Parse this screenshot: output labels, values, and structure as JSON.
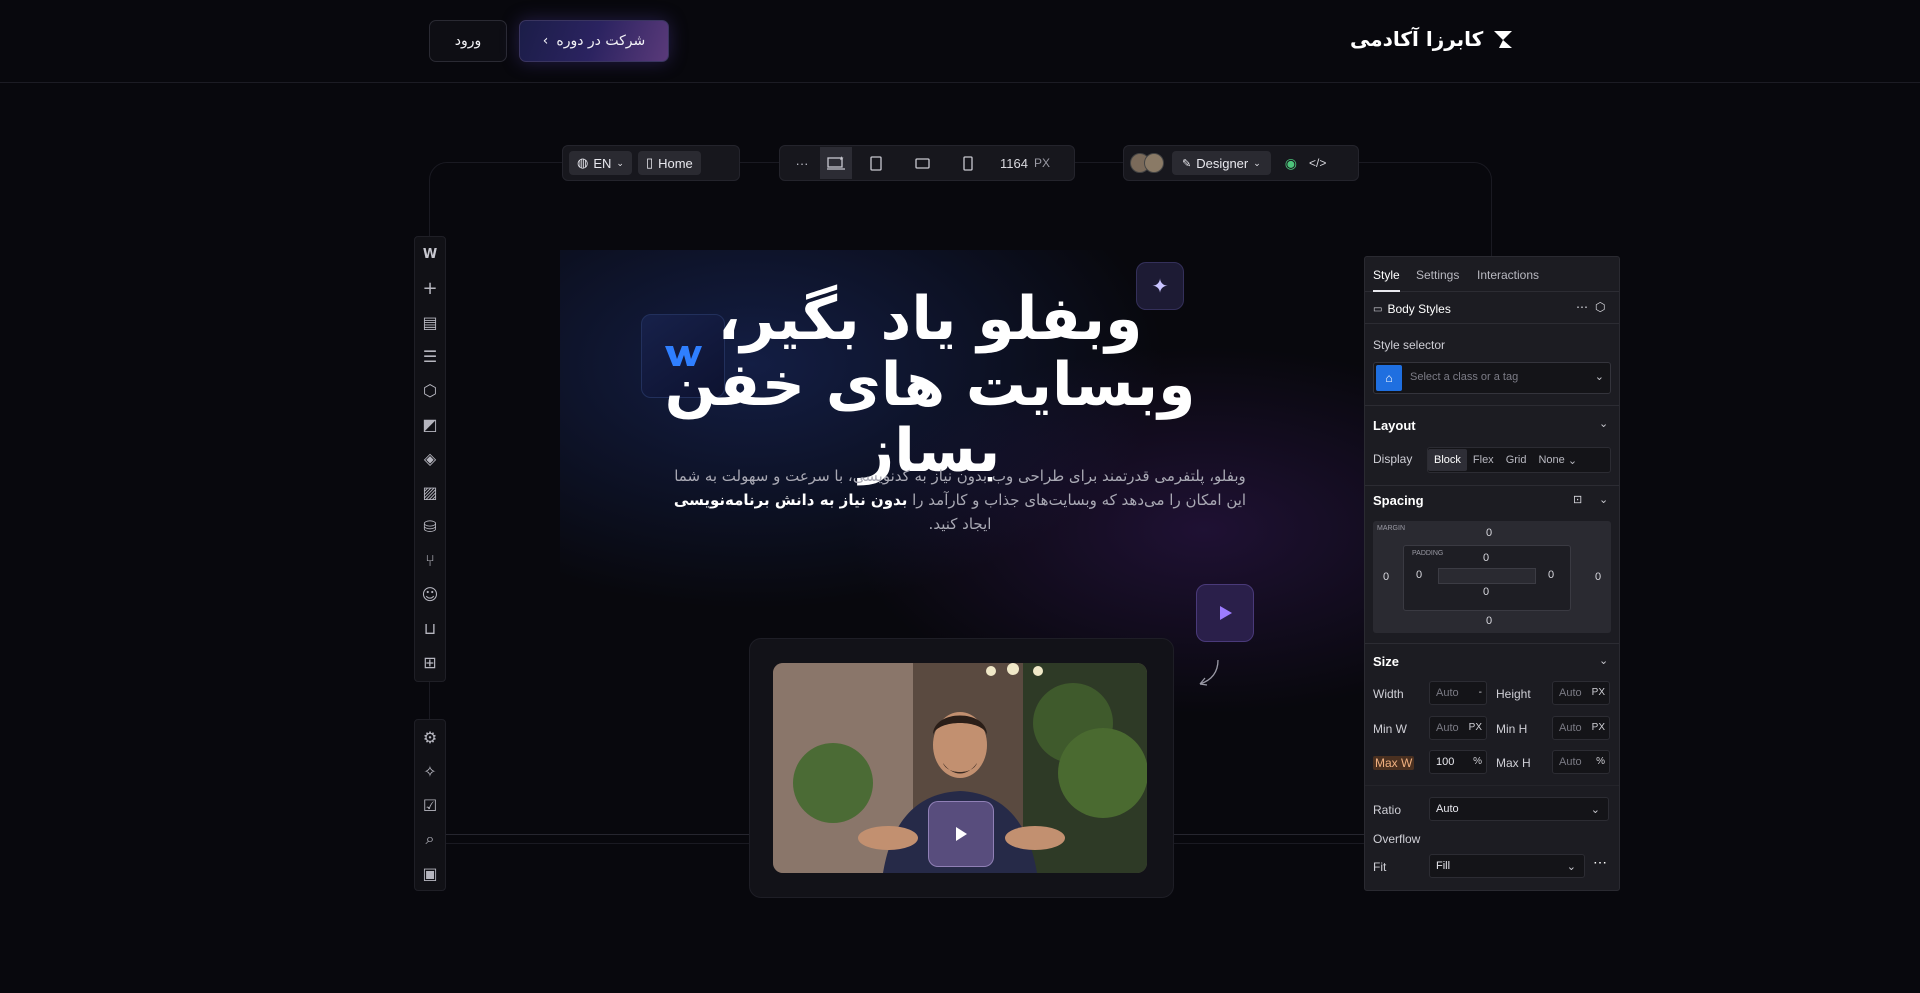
{
  "header": {
    "brand": "کابرزا آکادمی",
    "login_label": "ورود",
    "enroll_label": "شرکت در دوره"
  },
  "toolbar_left": {
    "lang": "EN",
    "page": "Home"
  },
  "toolbar_center": {
    "more": "···",
    "width_value": "1164",
    "width_unit": "PX"
  },
  "toolbar_right": {
    "mode": "Designer"
  },
  "hero": {
    "title_line1": "وبفلو یاد بگیر،",
    "title_line2": "وبسایت های خفن بساز",
    "desc_1": "وبفلو، پلتفرمی قدرتمند برای طراحی وب بدون نیاز به کدنویسی، با سرعت و سهولت به شما این امکان را می‌دهد که وبسایت‌های جذاب و کارآمد را ",
    "desc_bold": "بدون نیاز به دانش برنامه‌نویسی",
    "desc_2": " ایجاد کنید."
  },
  "panel": {
    "tabs": [
      "Style",
      "Settings",
      "Interactions"
    ],
    "body_styles": "Body Styles",
    "style_selector_label": "Style selector",
    "selector_placeholder": "Select a class or a tag",
    "layout": {
      "title": "Layout",
      "display_label": "Display",
      "options": [
        "Block",
        "Flex",
        "Grid",
        "None"
      ]
    },
    "spacing": {
      "title": "Spacing",
      "margin_label": "MARGIN",
      "padding_label": "PADDING",
      "margin_top": "0",
      "margin_right": "0",
      "margin_bottom": "0",
      "margin_left": "0",
      "padding_top": "0",
      "padding_right": "0",
      "padding_bottom": "0",
      "padding_left": "0"
    },
    "size": {
      "title": "Size",
      "width_label": "Width",
      "width_value": "Auto",
      "width_unit": "-",
      "height_label": "Height",
      "height_value": "Auto",
      "height_unit": "PX",
      "minw_label": "Min W",
      "minw_value": "Auto",
      "minw_unit": "PX",
      "minh_label": "Min H",
      "minh_value": "Auto",
      "minh_unit": "PX",
      "maxw_label": "Max W",
      "maxw_value": "100",
      "maxw_unit": "%",
      "maxh_label": "Max H",
      "maxh_value": "Auto",
      "maxh_unit": "%"
    },
    "ratio_label": "Ratio",
    "ratio_value": "Auto",
    "overflow_label": "Overflow",
    "fit_label": "Fit",
    "fit_value": "Fill"
  },
  "colors": {
    "accent_blue": "#1f6fe0",
    "accent_purple": "#8a6cf0",
    "maxw_highlight": "#e0a070"
  }
}
